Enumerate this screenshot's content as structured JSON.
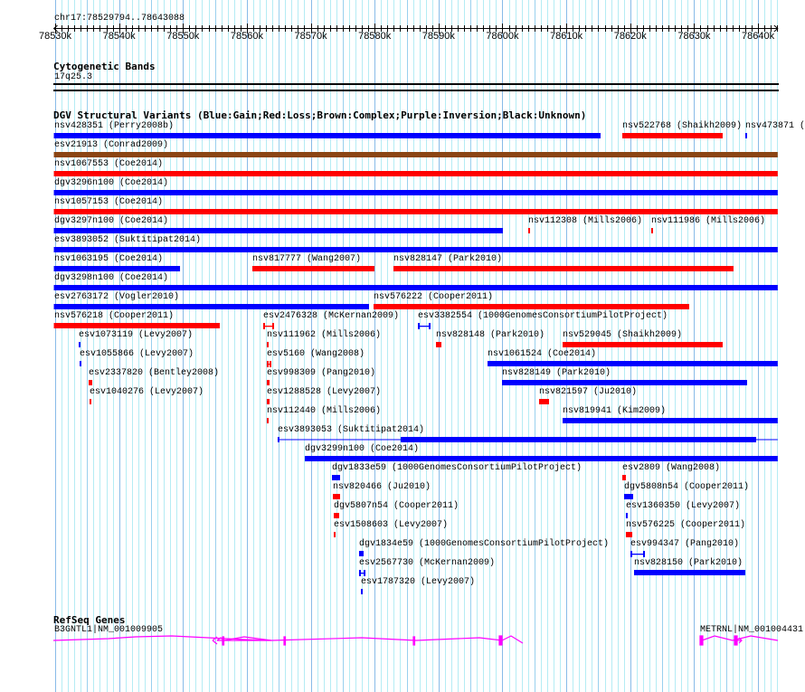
{
  "ruler": {
    "location": "chr17:78529794..78643088",
    "view_start_kb": 78529.794,
    "view_end_kb": 78643.088,
    "tick_labels": [
      "78530k",
      "78540k",
      "78550k",
      "78560k",
      "78570k",
      "78580k",
      "78590k",
      "78600k",
      "78610k",
      "78620k",
      "78630k",
      "78640k"
    ]
  },
  "cytoband": {
    "title": "Cytogenetic Bands",
    "band": "17q25.3"
  },
  "dgv": {
    "title": "DGV Structural Variants (Blue:Gain;Red:Loss;Brown:Complex;Purple:Inversion;Black:Unknown)",
    "colors": {
      "gain": "#0000ff",
      "loss": "#ff0000",
      "complex": "#8b4513"
    },
    "features": [
      {
        "row": 0,
        "label": "nsv428351 (Perry2008b)",
        "type": "gain",
        "shape": "bar",
        "start": 78529.794,
        "end": 78615.36
      },
      {
        "row": 0,
        "label": "nsv522768 (Shaikh2009)",
        "type": "loss",
        "shape": "bar",
        "start": 78618.76,
        "end": 78634.47
      },
      {
        "row": 0,
        "label": "nsv473871 (",
        "type": "gain",
        "shape": "bar",
        "start": 78638.01,
        "end": 78638.29
      },
      {
        "row": 1,
        "label": "esv21913 (Conrad2009)",
        "type": "complex",
        "shape": "bar",
        "start": 78529.794,
        "end": 78643.088
      },
      {
        "row": 2,
        "label": "nsv1067553 (Coe2014)",
        "type": "loss",
        "shape": "bar",
        "start": 78529.794,
        "end": 78643.088
      },
      {
        "row": 3,
        "label": "dgv3296n100 (Coe2014)",
        "type": "gain",
        "shape": "bar",
        "start": 78529.794,
        "end": 78643.088
      },
      {
        "row": 4,
        "label": "nsv1057153 (Coe2014)",
        "type": "loss",
        "shape": "bar",
        "start": 78529.794,
        "end": 78643.088
      },
      {
        "row": 5,
        "label": "dgv3297n100 (Coe2014)",
        "type": "gain",
        "shape": "bar",
        "start": 78529.794,
        "end": 78600.07
      },
      {
        "row": 5,
        "label": "nsv112308 (Mills2006)",
        "type": "loss",
        "shape": "bar",
        "start": 78604.04,
        "end": 78604.32
      },
      {
        "row": 5,
        "label": "nsv111986 (Mills2006)",
        "type": "loss",
        "shape": "bar",
        "start": 78623.29,
        "end": 78623.57
      },
      {
        "row": 6,
        "label": "esv3893052 (Suktitipat2014)",
        "type": "gain",
        "shape": "bar",
        "start": 78529.794,
        "end": 78643.088
      },
      {
        "row": 7,
        "label": "nsv1063195 (Coe2014)",
        "type": "gain",
        "shape": "bar",
        "start": 78529.794,
        "end": 78549.54
      },
      {
        "row": 7,
        "label": "nsv817777 (Wang2007)",
        "type": "loss",
        "shape": "bar",
        "start": 78560.86,
        "end": 78579.97
      },
      {
        "row": 7,
        "label": "nsv828147 (Park2010)",
        "type": "loss",
        "shape": "bar",
        "start": 78582.94,
        "end": 78636.17
      },
      {
        "row": 8,
        "label": "dgv3298n100 (Coe2014)",
        "type": "gain",
        "shape": "bar",
        "start": 78529.794,
        "end": 78643.088
      },
      {
        "row": 9,
        "label": "esv2763172 (Vogler2010)",
        "type": "gain",
        "shape": "bar",
        "start": 78529.794,
        "end": 78579.12
      },
      {
        "row": 9,
        "label": "nsv576222 (Cooper2011)",
        "type": "loss",
        "shape": "bar",
        "start": 78579.83,
        "end": 78629.23
      },
      {
        "row": 10,
        "label": "nsv576218 (Cooper2011)",
        "type": "loss",
        "shape": "bar",
        "start": 78529.794,
        "end": 78555.76
      },
      {
        "row": 10,
        "label": "esv2476328 (McKernan2009)",
        "type": "loss",
        "shape": "ibeam",
        "start": 78562.56,
        "end": 78564.26
      },
      {
        "row": 10,
        "label": "esv3382554 (1000GenomesConsortiumPilotProject)",
        "type": "gain",
        "shape": "ibeam",
        "start": 78586.77,
        "end": 78588.75
      },
      {
        "row": 11,
        "label": "esv1073119 (Levy2007)",
        "type": "gain",
        "shape": "bar",
        "start": 78533.68,
        "end": 78533.96
      },
      {
        "row": 11,
        "label": "nsv111962 (Mills2006)",
        "type": "loss",
        "shape": "bar",
        "start": 78563.12,
        "end": 78563.41
      },
      {
        "row": 11,
        "label": "nsv828148 (Park2010)",
        "type": "loss",
        "shape": "bar",
        "start": 78589.6,
        "end": 78590.45
      },
      {
        "row": 11,
        "label": "nsv529045 (Shaikh2009)",
        "type": "loss",
        "shape": "bar",
        "start": 78609.42,
        "end": 78634.47
      },
      {
        "row": 12,
        "label": "esv1055866 (Levy2007)",
        "type": "gain",
        "shape": "bar",
        "start": 78533.82,
        "end": 78534.11
      },
      {
        "row": 12,
        "label": "esv5160 (Wang2008)",
        "type": "loss",
        "shape": "ibeam",
        "start": 78563.12,
        "end": 78563.83
      },
      {
        "row": 12,
        "label": "nsv1061524 (Coe2014)",
        "type": "gain",
        "shape": "bar",
        "start": 78597.67,
        "end": 78643.088
      },
      {
        "row": 13,
        "label": "esv2337820 (Bentley2008)",
        "type": "loss",
        "shape": "bar",
        "start": 78535.24,
        "end": 78535.8
      },
      {
        "row": 13,
        "label": "esv998309 (Pang2010)",
        "type": "loss",
        "shape": "bar",
        "start": 78563.12,
        "end": 78563.55
      },
      {
        "row": 13,
        "label": "nsv828149 (Park2010)",
        "type": "gain",
        "shape": "bar",
        "start": 78599.93,
        "end": 78638.29
      },
      {
        "row": 14,
        "label": "esv1040276 (Levy2007)",
        "type": "loss",
        "shape": "bar",
        "start": 78535.38,
        "end": 78535.66
      },
      {
        "row": 14,
        "label": "esv1288528 (Levy2007)",
        "type": "loss",
        "shape": "bar",
        "start": 78563.12,
        "end": 78563.55
      },
      {
        "row": 14,
        "label": "nsv821597 (Ju2010)",
        "type": "loss",
        "shape": "bar",
        "start": 78605.73,
        "end": 78607.29
      },
      {
        "row": 15,
        "label": "nsv112440 (Mills2006)",
        "type": "loss",
        "shape": "bar",
        "start": 78563.12,
        "end": 78563.41
      },
      {
        "row": 15,
        "label": "nsv819941 (Kim2009)",
        "type": "gain",
        "shape": "bar",
        "start": 78609.42,
        "end": 78643.088
      },
      {
        "row": 16,
        "label": "esv3893053 (Suktitipat2014)",
        "type": "gain",
        "shape": "thick",
        "start": 78564.82,
        "end": 78643.088,
        "thick_start": 78584.08,
        "thick_end": 78639.71
      },
      {
        "row": 17,
        "label": "dgv3299n100 (Coe2014)",
        "type": "gain",
        "shape": "bar",
        "start": 78569.07,
        "end": 78643.088
      },
      {
        "row": 18,
        "label": "dgv1833e59 (1000GenomesConsortiumPilotProject)",
        "type": "gain",
        "shape": "bar",
        "start": 78573.32,
        "end": 78574.59
      },
      {
        "row": 18,
        "label": "esv2809 (Wang2008)",
        "type": "loss",
        "shape": "bar",
        "start": 78618.76,
        "end": 78619.32
      },
      {
        "row": 19,
        "label": "nsv820466 (Ju2010)",
        "type": "loss",
        "shape": "bar",
        "start": 78573.46,
        "end": 78574.59
      },
      {
        "row": 19,
        "label": "dgv5808n54 (Cooper2011)",
        "type": "gain",
        "shape": "bar",
        "start": 78619.04,
        "end": 78620.46
      },
      {
        "row": 20,
        "label": "dgv5807n54 (Cooper2011)",
        "type": "loss",
        "shape": "bar",
        "start": 78573.6,
        "end": 78574.45
      },
      {
        "row": 20,
        "label": "esv1360350 (Levy2007)",
        "type": "gain",
        "shape": "bar",
        "start": 78619.32,
        "end": 78619.47
      },
      {
        "row": 21,
        "label": "esv1508603 (Levy2007)",
        "type": "loss",
        "shape": "bar",
        "start": 78573.6,
        "end": 78573.88
      },
      {
        "row": 21,
        "label": "nsv576225 (Cooper2011)",
        "type": "loss",
        "shape": "bar",
        "start": 78619.32,
        "end": 78620.32
      },
      {
        "row": 22,
        "label": "dgv1834e59 (1000GenomesConsortiumPilotProject)",
        "type": "gain",
        "shape": "bar",
        "start": 78577.56,
        "end": 78578.27
      },
      {
        "row": 22,
        "label": "esv994347 (Pang2010)",
        "type": "gain",
        "shape": "ibeam",
        "start": 78620.03,
        "end": 78622.3
      },
      {
        "row": 23,
        "label": "esv2567730 (McKernan2009)",
        "type": "gain",
        "shape": "ibeam",
        "start": 78577.56,
        "end": 78578.56
      },
      {
        "row": 23,
        "label": "nsv828150 (Park2010)",
        "type": "gain",
        "shape": "bar",
        "start": 78620.6,
        "end": 78638.01
      },
      {
        "row": 24,
        "label": "esv1787320 (Levy2007)",
        "type": "gain",
        "shape": "bar",
        "start": 78577.85,
        "end": 78578.13
      }
    ]
  },
  "refseq": {
    "title": "RefSeq Genes",
    "color": "#ff00ff",
    "genes": [
      {
        "label": "B3GNTL1|NM_001009905"
      },
      {
        "label": "METRNL|NM_001004431"
      }
    ]
  }
}
